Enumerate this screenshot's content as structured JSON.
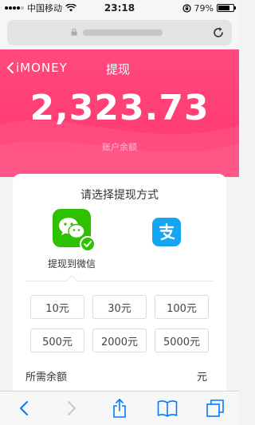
{
  "status_bar": {
    "carrier": "中国移动",
    "time": "23:18",
    "battery": "79%",
    "battery_level": 0.79
  },
  "browser": {
    "url": "",
    "lock_icon": "lock-icon",
    "reload_icon": "reload-icon"
  },
  "header": {
    "back_label": "iMONEY",
    "title": "提现"
  },
  "balance": {
    "amount": "2,323.73",
    "label": "账户余额"
  },
  "withdraw": {
    "title": "请选择提现方式",
    "methods": [
      {
        "name": "wechat",
        "label": "提现到微信",
        "selected": true,
        "icon": "wechat-icon"
      },
      {
        "name": "alipay",
        "label": "",
        "selected": false,
        "icon": "alipay-icon"
      }
    ],
    "amounts": [
      "10元",
      "30元",
      "100元",
      "500元",
      "2000元",
      "5000元"
    ],
    "required_label": "所需余额",
    "required_unit": "元"
  },
  "colors": {
    "accent": "#ff3d74",
    "wechat": "#2dc100",
    "alipay": "#14a6f0",
    "ios_blue": "#007aff"
  }
}
